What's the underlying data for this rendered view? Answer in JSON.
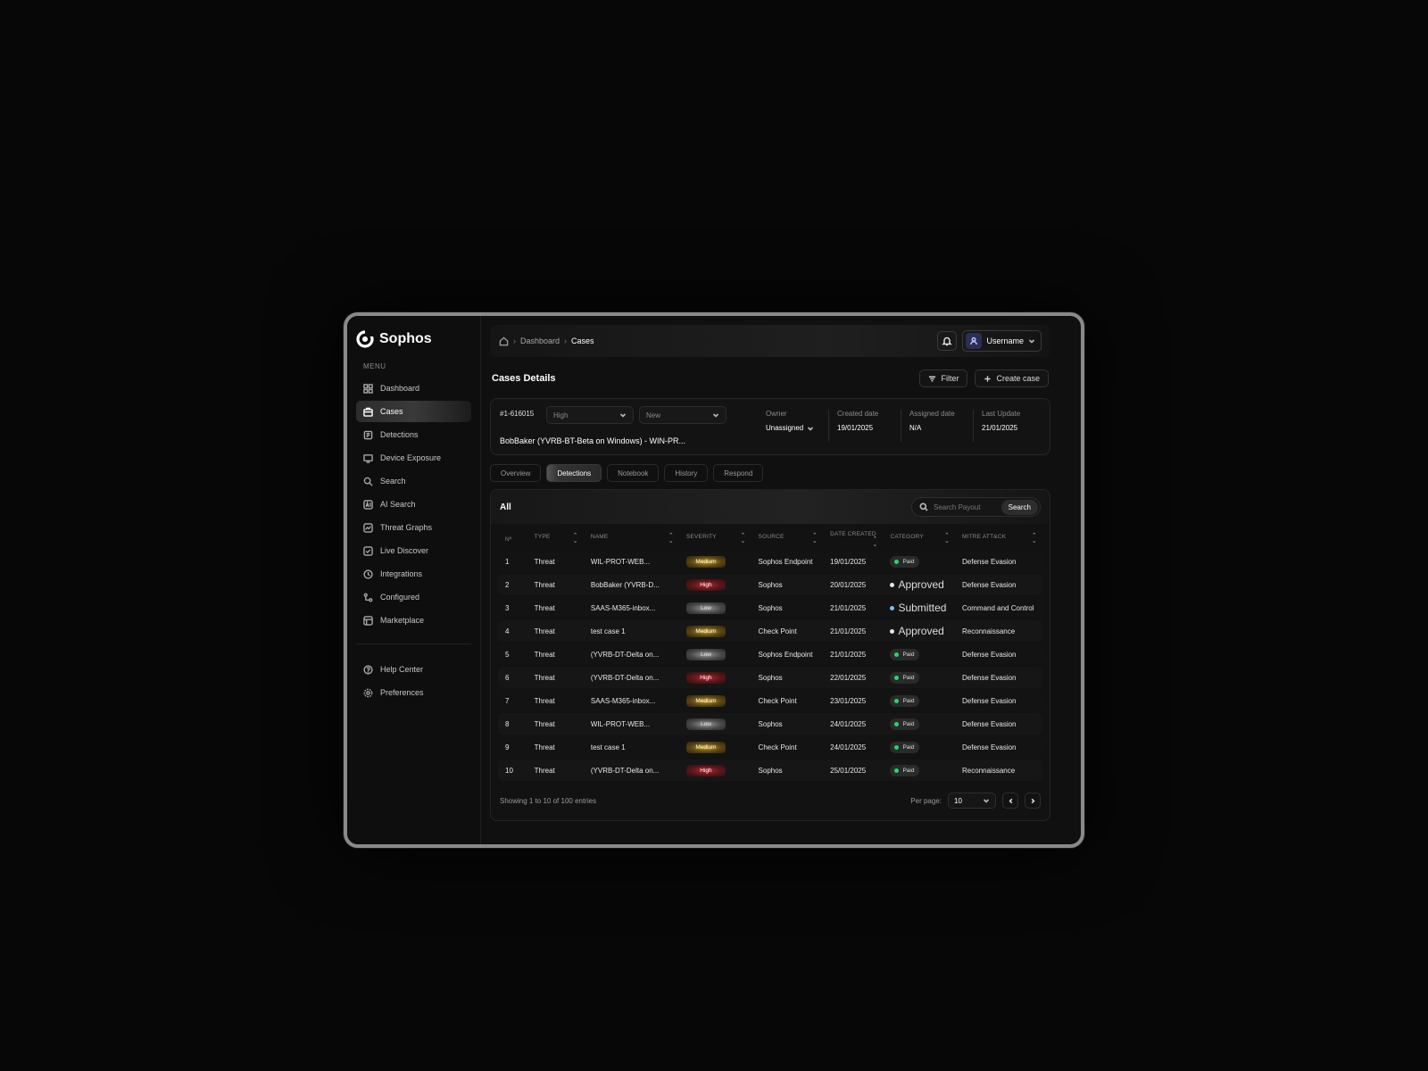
{
  "app": {
    "brand": "Sophos",
    "menu_label": "MENU",
    "nav": [
      {
        "label": "Dashboard",
        "icon": "grid-icon"
      },
      {
        "label": "Cases",
        "icon": "case-icon",
        "active": true
      },
      {
        "label": "Detections",
        "icon": "detections-icon"
      },
      {
        "label": "Device Exposure",
        "icon": "device-icon"
      },
      {
        "label": "Search",
        "icon": "search-icon"
      },
      {
        "label": "AI Search",
        "icon": "ai-icon"
      },
      {
        "label": "Threat Graphs",
        "icon": "graph-icon"
      },
      {
        "label": "Live Discover",
        "icon": "discover-icon"
      },
      {
        "label": "Integrations",
        "icon": "integrations-icon"
      },
      {
        "label": "Configured",
        "icon": "configured-icon"
      },
      {
        "label": "Marketplace",
        "icon": "marketplace-icon"
      }
    ],
    "nav_bottom": [
      {
        "label": "Help Center",
        "icon": "help-icon"
      },
      {
        "label": "Preferences",
        "icon": "preferences-icon"
      }
    ]
  },
  "header": {
    "breadcrumb": [
      "Dashboard",
      "Cases"
    ],
    "username": "Username"
  },
  "page": {
    "title": "Cases Details",
    "filter_label": "Filter",
    "create_label": "Create case"
  },
  "case": {
    "id": "#1-616015",
    "priority": "High",
    "status": "New",
    "name": "BobBaker (YVRB-BT-Beta on Windows) - WIN-PR...",
    "owner_label": "Owner",
    "owner_value": "Unassigned",
    "created_label": "Created date",
    "created_value": "19/01/2025",
    "assigned_label": "Assigned date",
    "assigned_value": "N/A",
    "updated_label": "Last Update",
    "updated_value": "21/01/2025"
  },
  "tabs": [
    "Overview",
    "Detections",
    "Notebook",
    "History",
    "Respond"
  ],
  "active_tab": "Detections",
  "detections": {
    "title": "All",
    "search_placeholder": "Search Payout",
    "search_button": "Search",
    "columns": [
      "Nº",
      "TYPE",
      "NAME",
      "SEVERITY",
      "SOURCE",
      "DATE CREATED",
      "CATEGORY",
      "MITRE ATT&CK"
    ],
    "rows": [
      {
        "n": "1",
        "type": "Threat",
        "name": "WIL-PROT-WEB...",
        "severity": "Medium",
        "source": "Sophos Endpoint",
        "date": "19/01/2025",
        "category": "Paid",
        "mitre": "Defense Evasion"
      },
      {
        "n": "2",
        "type": "Threat",
        "name": "BobBaker (YVRB-D...",
        "severity": "High",
        "source": "Sophos",
        "date": "20/01/2025",
        "category": "Approved",
        "mitre": "Defense Evasion"
      },
      {
        "n": "3",
        "type": "Threat",
        "name": "SAAS-M365-inbox...",
        "severity": "Low",
        "source": "Sophos",
        "date": "21/01/2025",
        "category": "Submitted",
        "mitre": "Command and Control"
      },
      {
        "n": "4",
        "type": "Threat",
        "name": "test case 1",
        "severity": "Medium",
        "source": "Check Point",
        "date": "21/01/2025",
        "category": "Approved",
        "mitre": "Reconnaissance"
      },
      {
        "n": "5",
        "type": "Threat",
        "name": "(YVRB-DT-Delta on...",
        "severity": "Low",
        "source": "Sophos Endpoint",
        "date": "21/01/2025",
        "category": "Paid",
        "mitre": "Defense Evasion"
      },
      {
        "n": "6",
        "type": "Threat",
        "name": "(YVRB-DT-Delta on...",
        "severity": "High",
        "source": "Sophos",
        "date": "22/01/2025",
        "category": "Paid",
        "mitre": "Defense Evasion"
      },
      {
        "n": "7",
        "type": "Threat",
        "name": "SAAS-M365-inbox...",
        "severity": "Medium",
        "source": "Check Point",
        "date": "23/01/2025",
        "category": "Paid",
        "mitre": "Defense Evasion"
      },
      {
        "n": "8",
        "type": "Threat",
        "name": "WIL-PROT-WEB...",
        "severity": "Low",
        "source": "Sophos",
        "date": "24/01/2025",
        "category": "Paid",
        "mitre": "Defense Evasion"
      },
      {
        "n": "9",
        "type": "Threat",
        "name": "test case 1",
        "severity": "Medium",
        "source": "Check Point",
        "date": "24/01/2025",
        "category": "Paid",
        "mitre": "Defense Evasion"
      },
      {
        "n": "10",
        "type": "Threat",
        "name": "(YVRB-DT-Delta on...",
        "severity": "High",
        "source": "Sophos",
        "date": "25/01/2025",
        "category": "Paid",
        "mitre": "Reconnaissance"
      }
    ],
    "footer_text": "Showing 1 to 10 of 100 entries",
    "per_page_label": "Per page:",
    "per_page_value": "10"
  },
  "colors": {
    "background": "#070707",
    "surface": "#101010",
    "paid_dot": "#2bd46a",
    "submitted_dot": "#6cc3ff",
    "high": "#b8232b",
    "medium": "#c79a18",
    "low": "#9a9a9a",
    "avatar": "#2a2f55"
  }
}
